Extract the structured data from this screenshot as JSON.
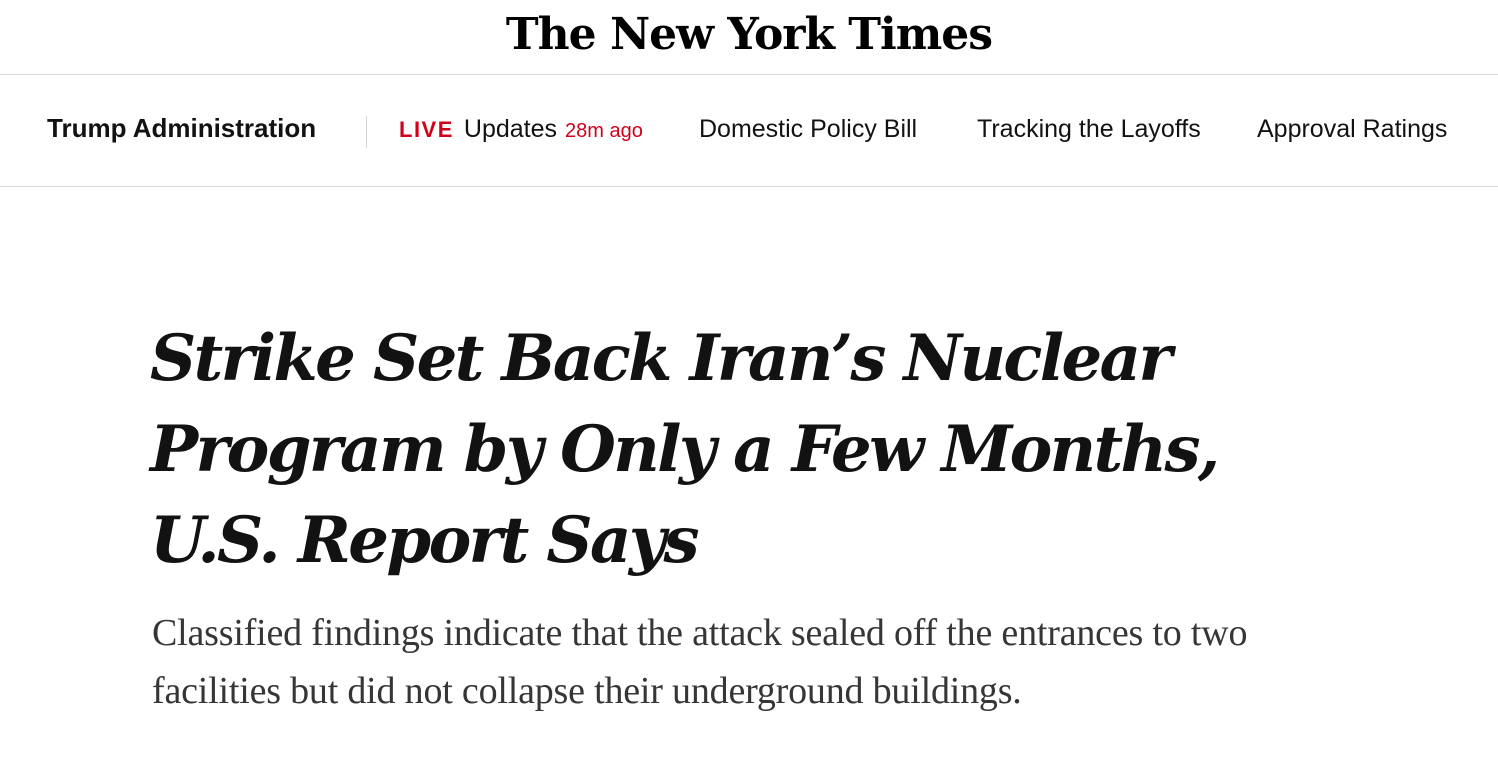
{
  "masthead": {
    "logo": "The New York Times"
  },
  "subnav": {
    "section": "Trump Administration",
    "live": {
      "badge": "LIVE",
      "label": "Updates",
      "time": "28m ago"
    },
    "links": [
      {
        "label": "Domestic Policy Bill"
      },
      {
        "label": "Tracking the Layoffs"
      },
      {
        "label": "Approval Ratings"
      }
    ]
  },
  "article": {
    "headline": "Strike Set Back Iran’s Nuclear Program by Only a Few Months, U.S. Report Says",
    "summary": "Classified findings indicate that the attack sealed off the entrances to two facilities but did not collapse their underground buildings."
  },
  "colors": {
    "live_red": "#d0021b",
    "text": "#121212",
    "summary_text": "#363636",
    "divider": "#dcdcdc"
  }
}
